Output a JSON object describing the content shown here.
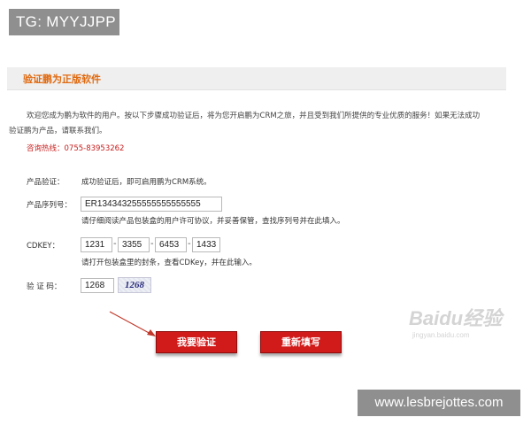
{
  "overlay": {
    "tag_label": "TG: MYYJJPP",
    "site_watermark": "www.lesbrejottes.com",
    "baidu_watermark_main": "Baidu经验",
    "baidu_watermark_sub": "jingyan.baidu.com"
  },
  "header": {
    "title": "验证鹏为正版软件"
  },
  "intro": {
    "line1": "欢迎您成为鹏为软件的用户。按以下步骤成功验证后，将为您开启鹏为CRM之旅，并且受到我们所提供的专业优质的服务！如果无法成功",
    "line2": "验证鹏为产品，请联系我们。",
    "hotline": "咨询热线：0755-83953262"
  },
  "form": {
    "product_verify": {
      "label": "产品验证：",
      "text": "成功验证后，即可启用鹏为CRM系统。"
    },
    "serial": {
      "label": "产品序列号：",
      "value": "ER134343255555555555555",
      "hint": "请仔细阅读产品包装盒的用户许可协议，并妥善保管，查找序列号并在此填入。"
    },
    "cdkey": {
      "label": "CDKEY：",
      "parts": [
        "1231",
        "3355",
        "6453",
        "1433"
      ],
      "separator": "-",
      "hint": "请打开包装盒里的封条，查看CDKey，并在此输入。"
    },
    "captcha": {
      "label": "验 证 码：",
      "value": "1268",
      "image_text": "1268"
    }
  },
  "buttons": {
    "verify": "我要验证",
    "reset": "重新填写"
  },
  "colors": {
    "title": "#e06a10",
    "hotline": "#c81c1c",
    "button": "#d11a1a",
    "arrow": "#c0392b"
  }
}
